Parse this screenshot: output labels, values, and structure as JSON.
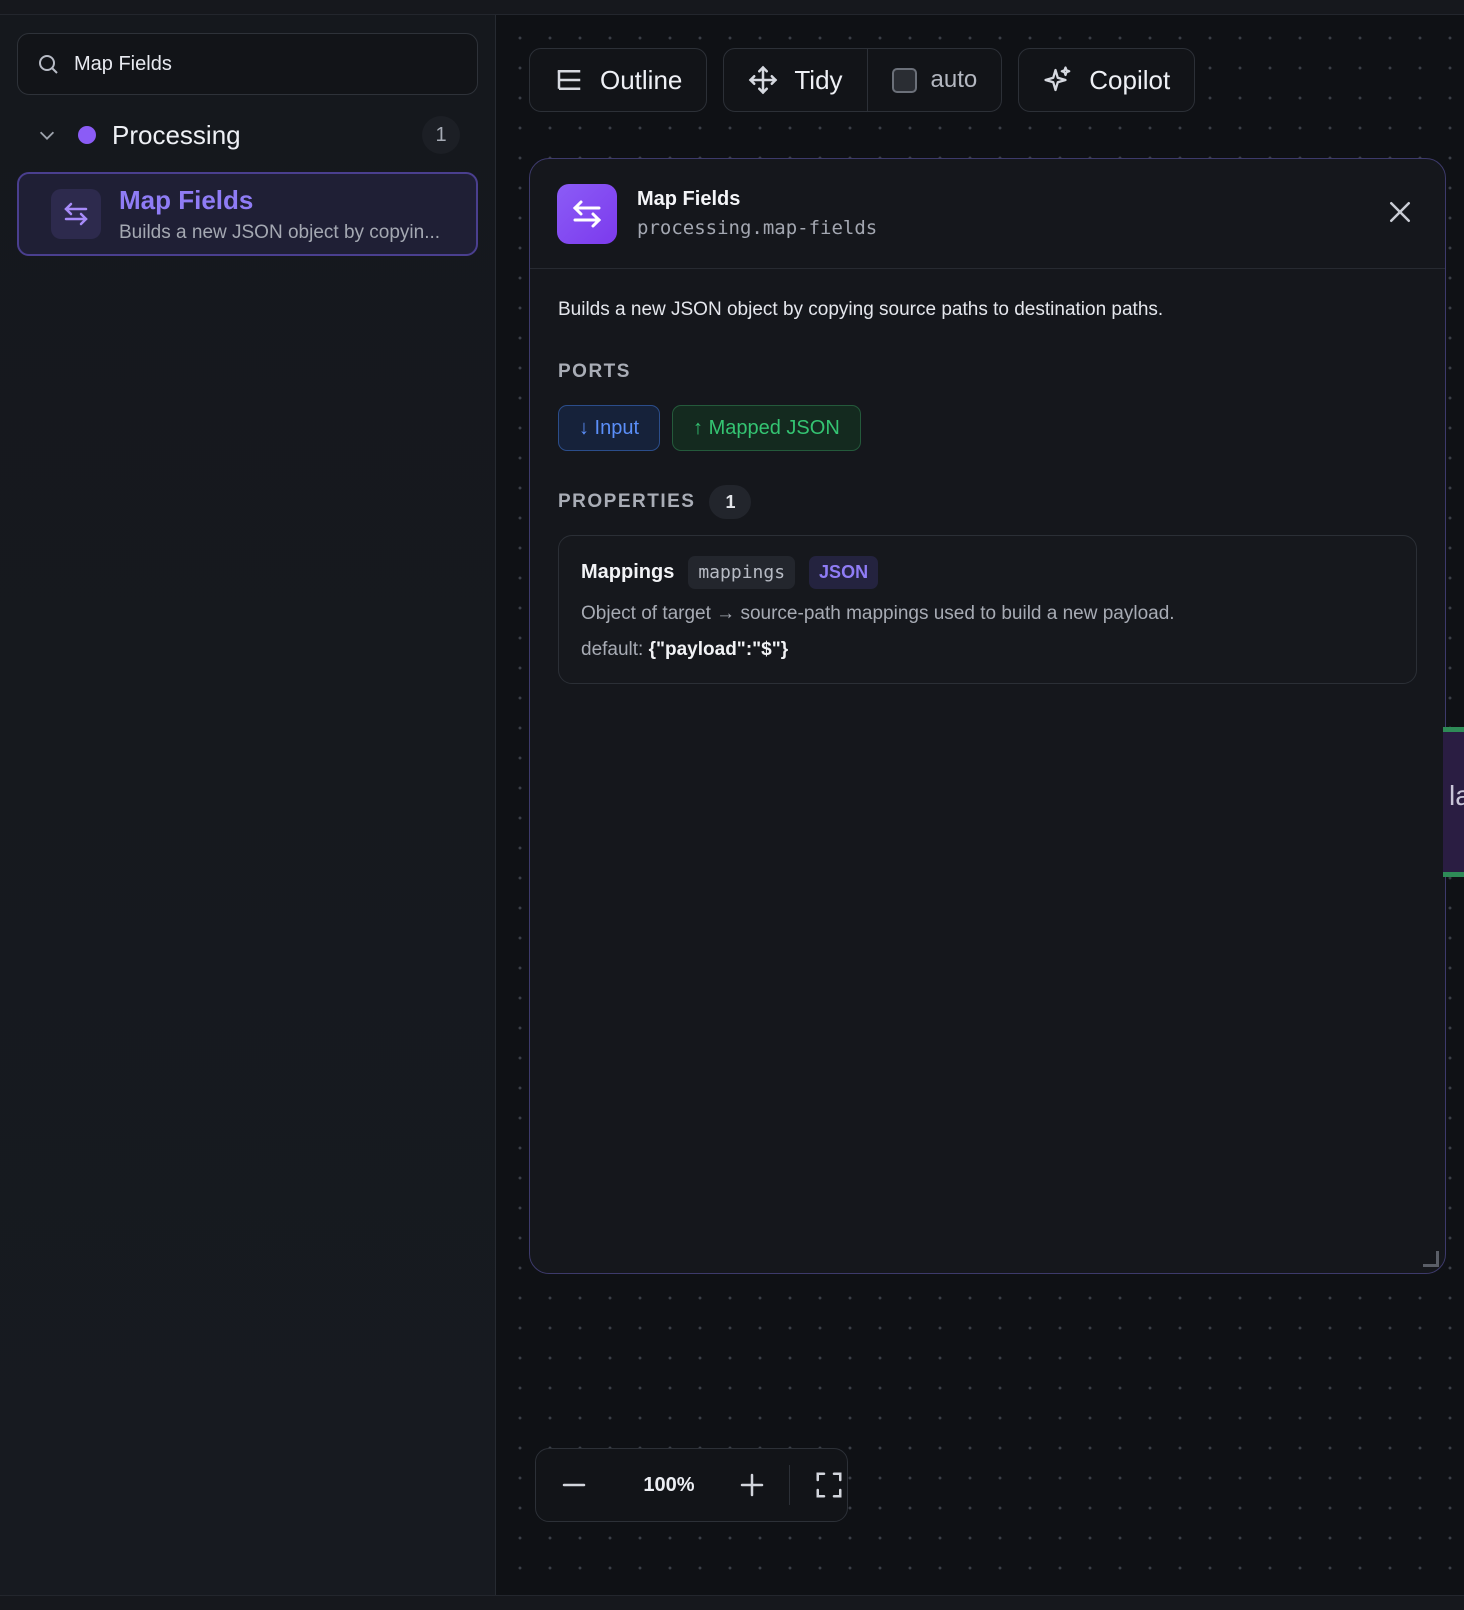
{
  "sidebar": {
    "search": {
      "value": "Map Fields",
      "icon": "search-icon"
    },
    "group": {
      "label": "Processing",
      "count": "1",
      "color": "#8b5cf6"
    },
    "items": [
      {
        "title": "Map Fields",
        "description": "Builds a new JSON object by copyin...",
        "icon": "arrows-left-right-icon"
      }
    ]
  },
  "toolbar": {
    "outline_label": "Outline",
    "tidy_label": "Tidy",
    "auto_label": "auto",
    "auto_checked": false,
    "copilot_label": "Copilot"
  },
  "panel": {
    "title": "Map Fields",
    "id": "processing.map-fields",
    "description": "Builds a new JSON object by copying source paths to destination paths.",
    "ports_heading": "PORTS",
    "ports": {
      "input": "↓ Input",
      "output": "↑ Mapped JSON"
    },
    "properties_heading": "PROPERTIES",
    "properties_count": "1",
    "properties": [
      {
        "name": "Mappings",
        "key": "mappings",
        "type": "JSON",
        "description": "Object of target → source-path mappings used to build a new payload.",
        "default_label": "default:",
        "default_value": "{\"payload\":\"$\"}"
      }
    ]
  },
  "canvas": {
    "partial_node_text": "la"
  },
  "zoom": {
    "value": "100%"
  },
  "colors": {
    "accent": "#8b5cf6",
    "input_port": "#5b8ff9",
    "output_port": "#34c472",
    "background": "#0f1115"
  }
}
